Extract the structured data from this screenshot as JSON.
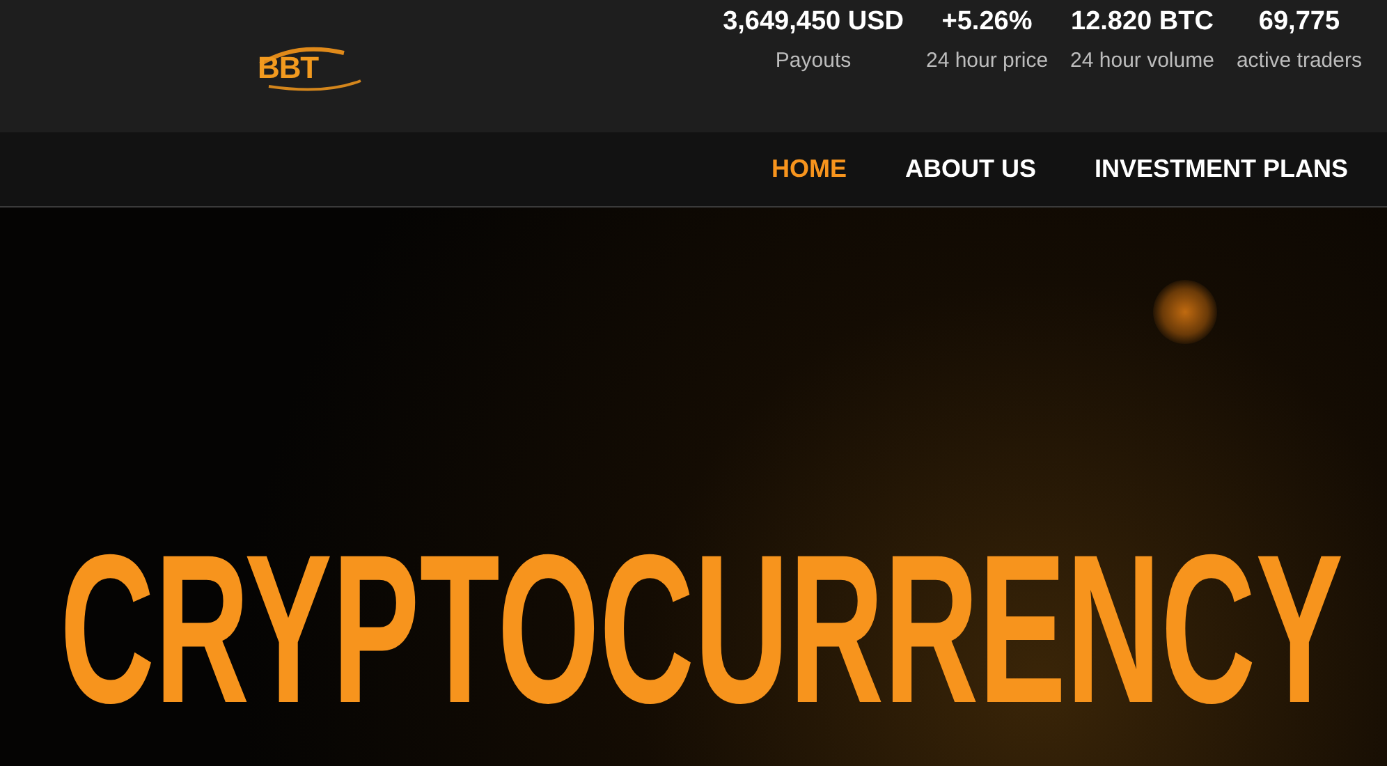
{
  "logo": {
    "text": "BBT"
  },
  "stats": [
    {
      "value": "3,649,450 USD",
      "label": "Payouts"
    },
    {
      "value": "+5.26%",
      "label": "24 hour price"
    },
    {
      "value": "12.820 BTC",
      "label": "24 hour volume"
    },
    {
      "value": "69,775",
      "label": "active traders"
    }
  ],
  "nav": [
    {
      "label": "HOME",
      "selected": true
    },
    {
      "label": "ABOUT US",
      "selected": false
    },
    {
      "label": "INVESTMENT PLANS",
      "selected": false
    }
  ],
  "hero": {
    "headline": "CRYPTOCURRENCY"
  }
}
